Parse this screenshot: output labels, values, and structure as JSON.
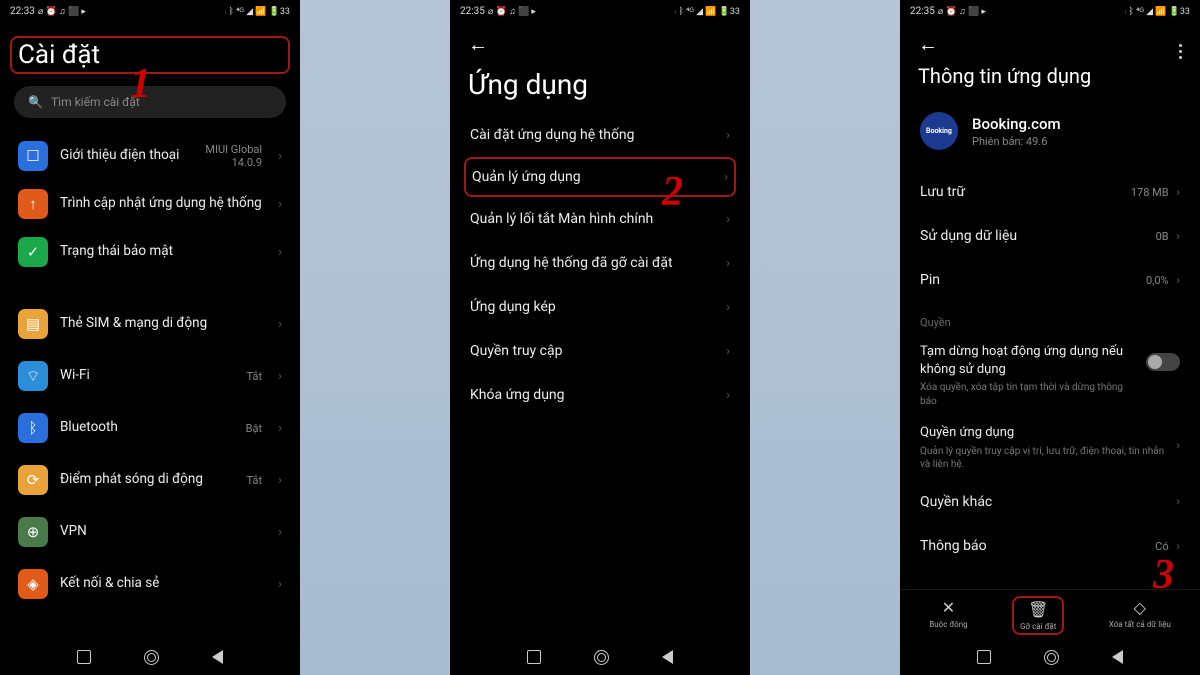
{
  "status": {
    "time1": "22:33",
    "time2": "22:35",
    "time3": "22:35",
    "icons_left": "⌀ ⏰ ♫ ⬛ ▸",
    "icons_right": "⋮ᛒ ⁴ᴳ ◢ 📶 🔋33"
  },
  "screen1": {
    "title": "Cài đặt",
    "search_placeholder": "Tìm kiếm cài đặt",
    "items": [
      {
        "label": "Giới thiệu điện thoại",
        "sub": "MIUI Global\n14.0.9",
        "color": "#2a6fdb",
        "glyph": "☐"
      },
      {
        "label": "Trình cập nhật ứng dụng hệ thống",
        "sub": "",
        "color": "#e05a1a",
        "glyph": "↑"
      },
      {
        "label": "Trạng thái bảo mật",
        "sub": "",
        "color": "#1aa84a",
        "glyph": "✓"
      }
    ],
    "items2": [
      {
        "label": "Thẻ SIM & mạng di động",
        "sub": "",
        "color": "#e8a43a",
        "glyph": "▤"
      },
      {
        "label": "Wi-Fi",
        "sub": "Tắt",
        "color": "#2a8fd8",
        "glyph": "⌔"
      },
      {
        "label": "Bluetooth",
        "sub": "Bật",
        "color": "#2a6fdb",
        "glyph": "ᛒ"
      },
      {
        "label": "Điểm phát sóng di động",
        "sub": "Tắt",
        "color": "#e8a43a",
        "glyph": "⟳"
      },
      {
        "label": "VPN",
        "sub": "",
        "color": "#4a7a4a",
        "glyph": "⊕"
      },
      {
        "label": "Kết nối & chia sẻ",
        "sub": "",
        "color": "#e05a1a",
        "glyph": "◈"
      }
    ],
    "annotation": "1"
  },
  "screen2": {
    "title": "Ứng dụng",
    "items": [
      "Cài đặt ứng dụng hệ thống",
      "Quản lý ứng dụng",
      "Quản lý lối tắt Màn hình chính",
      "Ứng dụng hệ thống đã gỡ cài đặt",
      "Ứng dụng kép",
      "Quyền truy cập",
      "Khóa ứng dụng"
    ],
    "annotation": "2"
  },
  "screen3": {
    "title": "Thông tin ứng dụng",
    "app_name": "Booking.com",
    "app_version": "Phiên bản: 49.6",
    "rows": [
      {
        "label": "Lưu trữ",
        "value": "178 MB"
      },
      {
        "label": "Sử dụng dữ liệu",
        "value": "0B"
      },
      {
        "label": "Pin",
        "value": "0,0%"
      }
    ],
    "section_perm": "Quyền",
    "pause_title": "Tạm dừng hoạt động ứng dụng nếu không sử dụng",
    "pause_desc": "Xóa quyền, xóa tập tin tạm thời và dừng thông báo",
    "perm_app_title": "Quyền ứng dụng",
    "perm_app_desc": "Quản lý quyền truy cập vị trí, lưu trữ, điện thoại, tin nhắn và liên hệ.",
    "other_perm": "Quyền khác",
    "notif_label": "Thông báo",
    "notif_value": "Có",
    "actions": [
      {
        "label": "Buộc đóng",
        "icon": "✕"
      },
      {
        "label": "Gỡ cài đặt",
        "icon": "🗑"
      },
      {
        "label": "Xóa tất cả dữ liệu",
        "icon": "◇"
      }
    ],
    "annotation": "3"
  }
}
